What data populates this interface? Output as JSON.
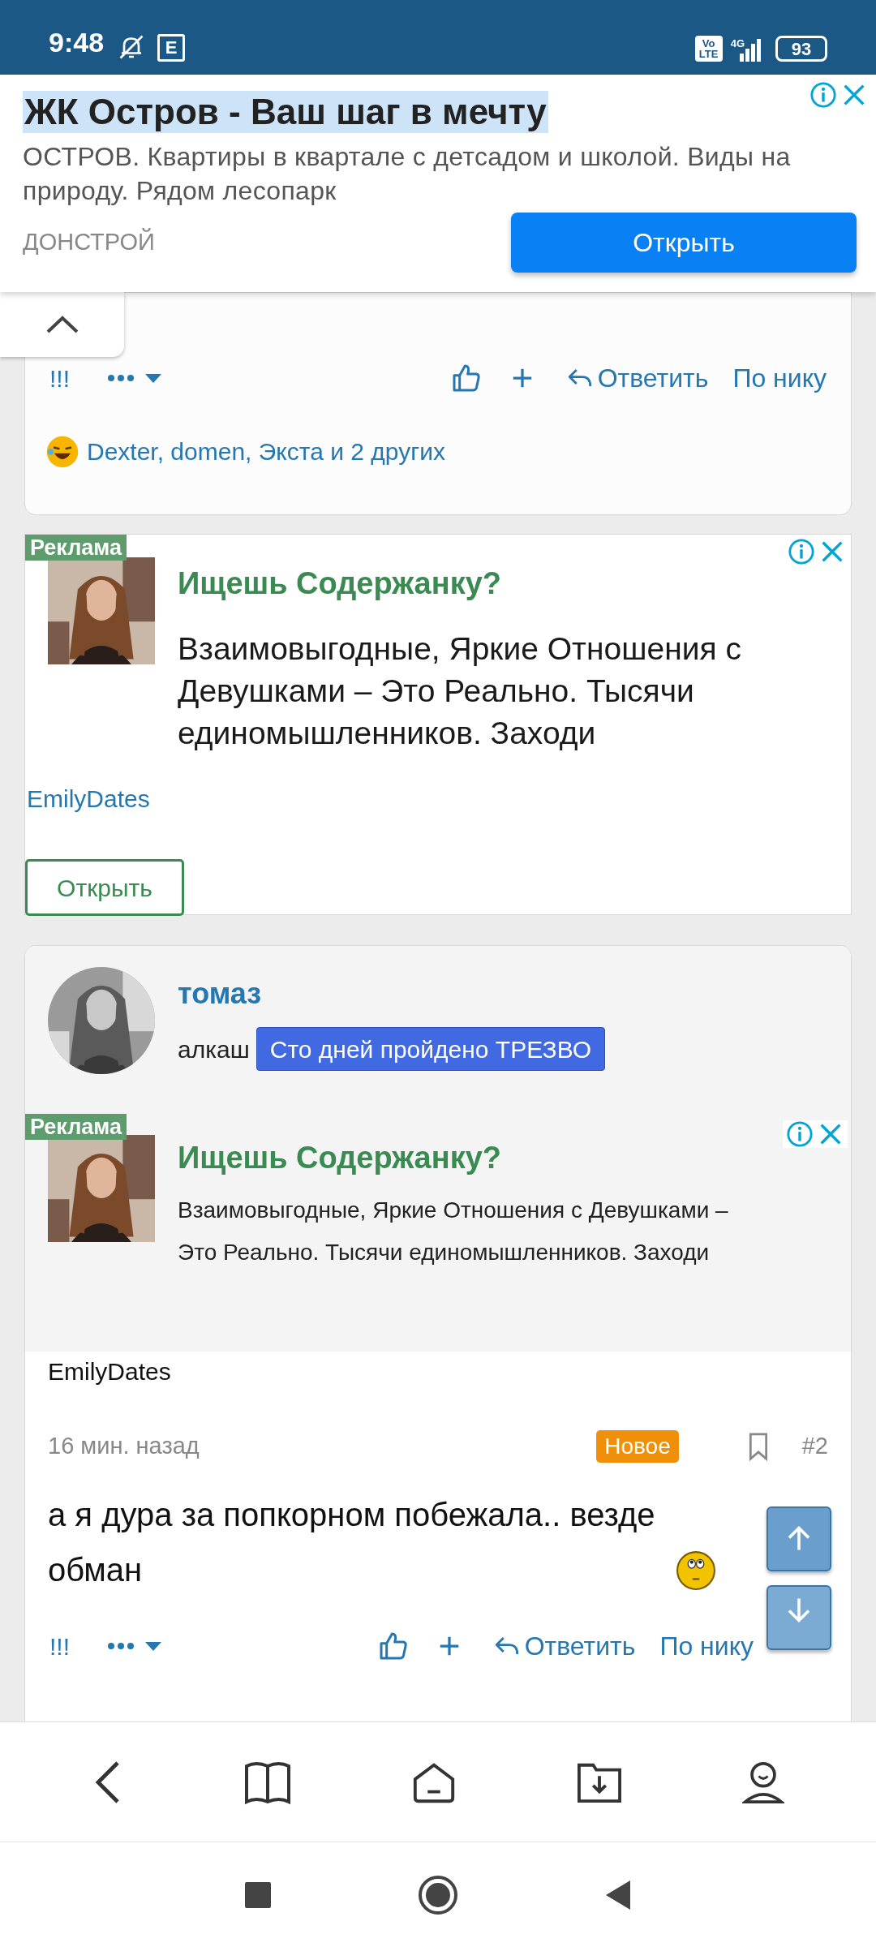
{
  "status_bar": {
    "time": "9:48",
    "notification_letter": "E",
    "volte": [
      "Vo",
      "LTE"
    ],
    "network": "4G",
    "battery": "93"
  },
  "top_ad": {
    "title": "ЖК Остров - Ваш шаг в мечту",
    "body": "ОСТРОВ. Квартиры в квартале с детсадом и школой. Виды на природу. Рядом лесопарк",
    "advertiser": "ДОНСТРОЙ",
    "button": "Открыть"
  },
  "post_1": {
    "actions": {
      "flag": "!!!",
      "reply": "Ответить",
      "by_nick": "По нику"
    },
    "reactions": "Dexter, domen, Экста и 2 других"
  },
  "ad_2": {
    "label": "Реклама",
    "title": "Ищешь Содержанку?",
    "body": "Взаимовыгодные, Яркие Отношения с Девушками – Это Реально. Тысячи единомышленников. Заходи",
    "advertiser": "EmilyDates",
    "button": "Открыть"
  },
  "post_2": {
    "author": "томаз",
    "role": "алкаш",
    "badge": "Сто дней пройдено ТРЕЗВО",
    "ad": {
      "label": "Реклама",
      "title": "Ищешь Содержанку?",
      "body": "Взаимовыгодные, Яркие Отношения с Девушками – Это Реально. Тысячи единомышленников. Заходи",
      "advertiser": "EmilyDates"
    },
    "time": "16 мин. назад",
    "new_badge": "Новое",
    "number": "#2",
    "message": "а я дура за попкорном побежала.. везде обман",
    "actions": {
      "flag": "!!!",
      "reply": "Ответить",
      "by_nick": "По нику"
    }
  }
}
